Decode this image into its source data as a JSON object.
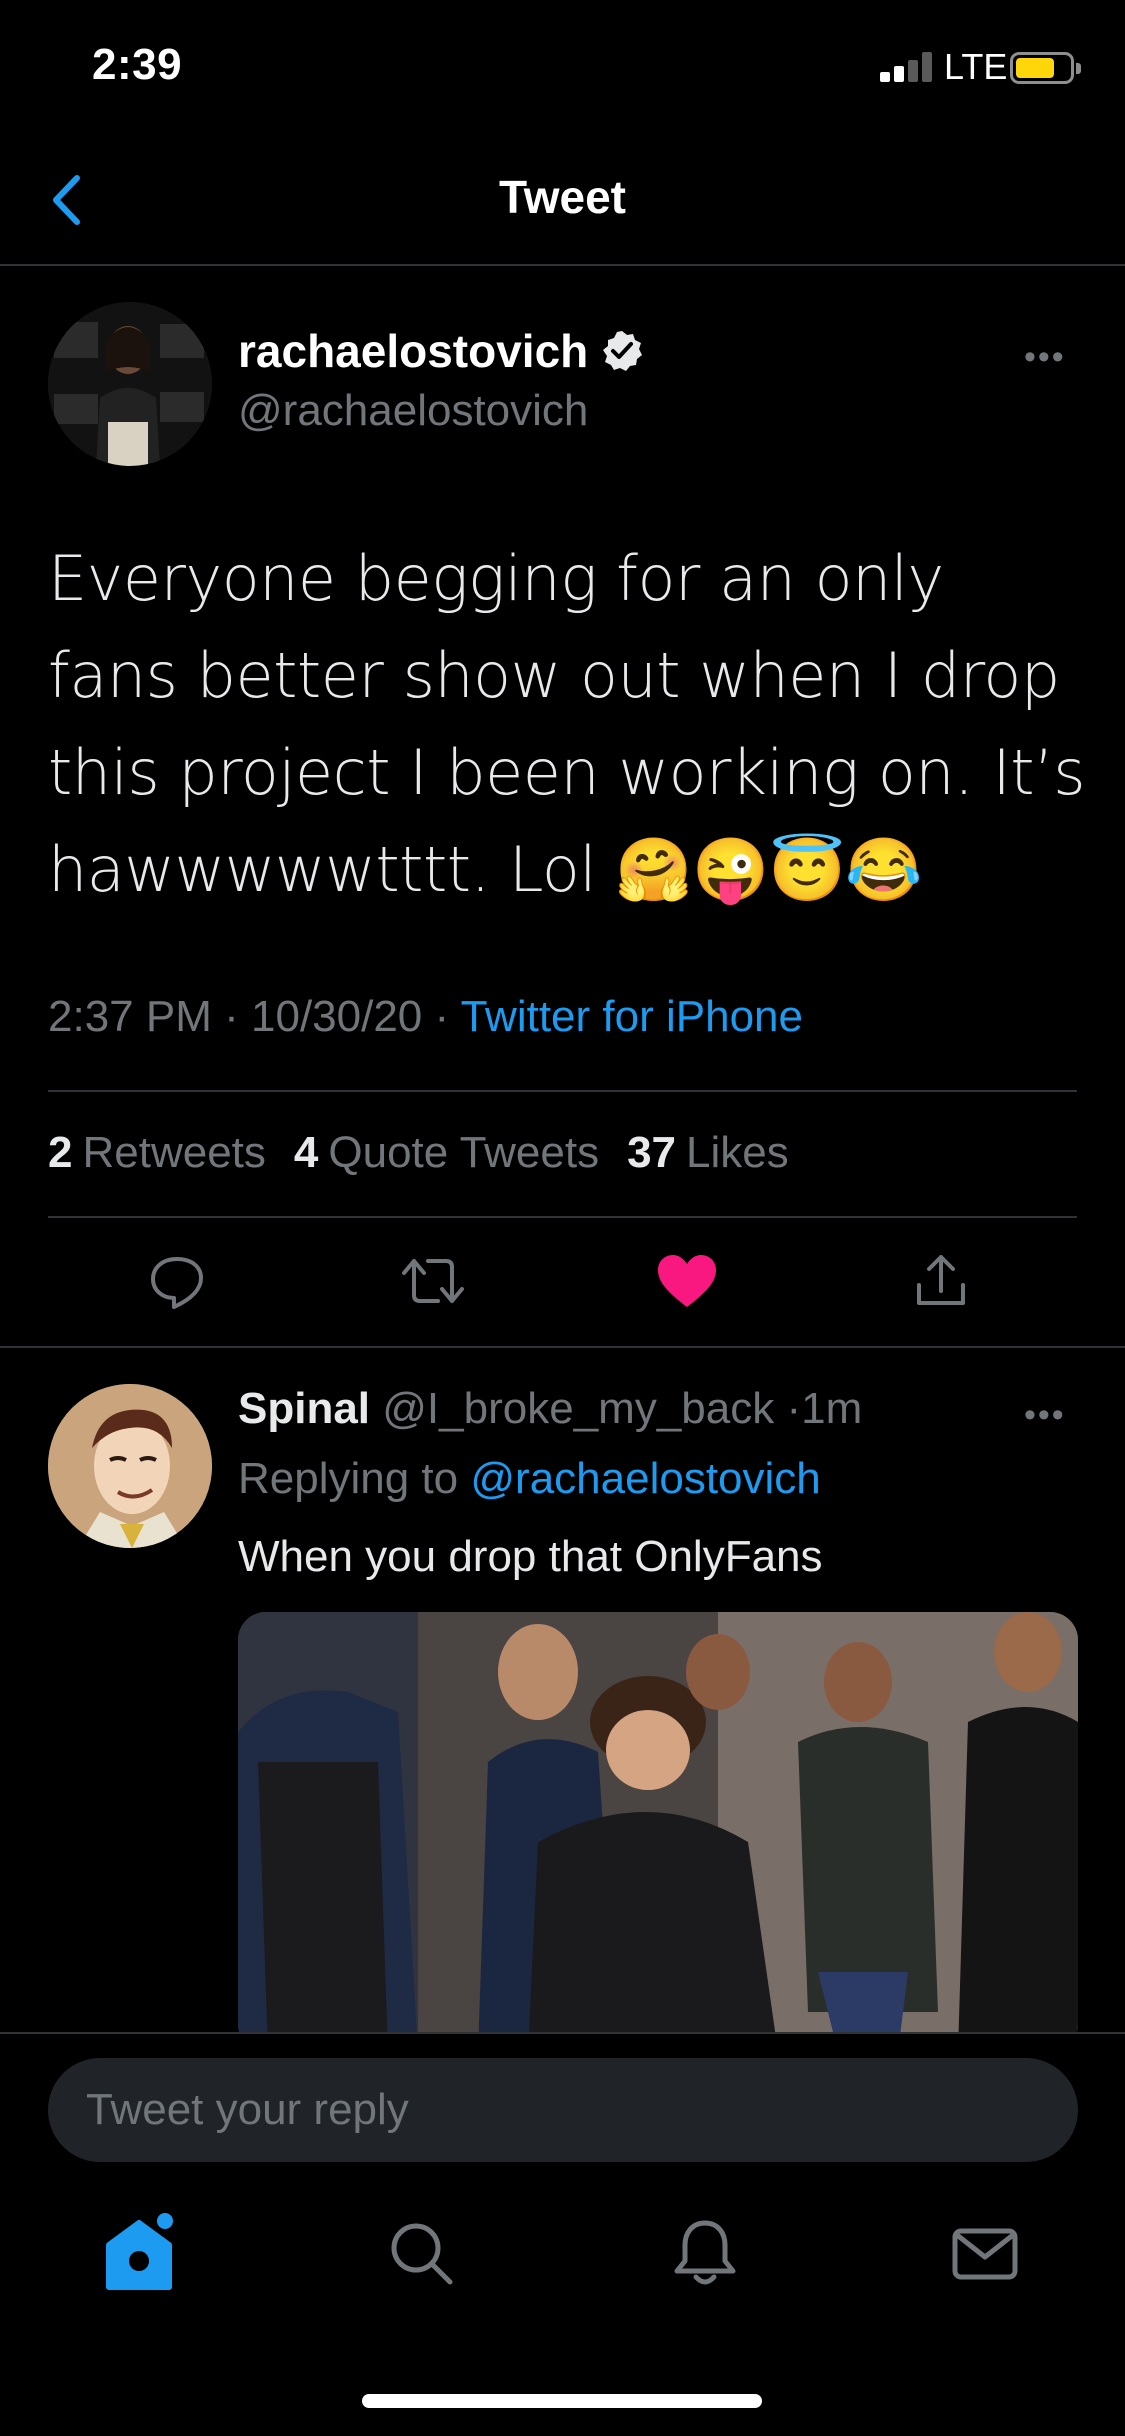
{
  "status_bar": {
    "time": "2:39",
    "network": "LTE"
  },
  "header": {
    "title": "Tweet"
  },
  "tweet": {
    "author_name": "rachaelostovich",
    "author_handle": "@rachaelostovich",
    "text": "Everyone begging for an only fans better show out when I drop this project I been working on. It’s hawwwwwtttt. Lol 🤗😜😇😂",
    "time": "2:37 PM",
    "date": "10/30/20",
    "client": "Twitter for iPhone",
    "retweets_count": "2",
    "retweets_label": "Retweets",
    "quotes_count": "4",
    "quotes_label": "Quote Tweets",
    "likes_count": "37",
    "likes_label": "Likes",
    "liked": true
  },
  "reply": {
    "name": "Spinal",
    "handle": "@I_broke_my_back",
    "time": "1m",
    "replying_prefix": "Replying to",
    "replying_to": "@rachaelostovich",
    "text": "When you drop that OnlyFans"
  },
  "composer": {
    "placeholder": "Tweet your reply"
  },
  "colors": {
    "accent": "#1d9bf0",
    "like": "#f91880",
    "background": "#000000",
    "muted": "#71767b"
  },
  "icons": {
    "header": [
      "back-arrow-icon"
    ],
    "actions": [
      "reply-icon",
      "retweet-icon",
      "heart-icon",
      "share-icon"
    ],
    "tabs": [
      "home-icon",
      "search-icon",
      "bell-icon",
      "mail-icon"
    ]
  }
}
